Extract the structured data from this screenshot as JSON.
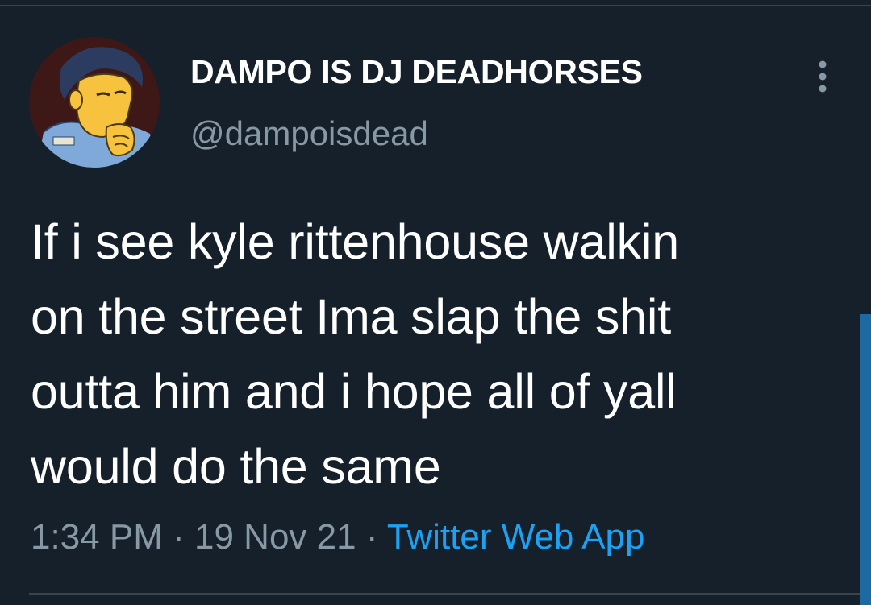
{
  "tweet": {
    "author": {
      "display_name": "DAMPO IS DJ DEADHORSES",
      "handle": "@dampoisdead",
      "avatar_icon": "cartoon-avatar"
    },
    "more_icon": "more-vertical-icon",
    "text_lines": [
      "If i see kyle rittenhouse walkin",
      "on the street Ima slap the shit",
      "outta him and i hope all of yall",
      "would do the same"
    ],
    "time": "1:34 PM",
    "separator": "·",
    "date": "19 Nov 21",
    "source": "Twitter Web App"
  },
  "colors": {
    "background": "#15202b",
    "text_primary": "#ffffff",
    "text_secondary": "#8899a6",
    "link": "#1da1f2",
    "divider": "#38444d"
  }
}
